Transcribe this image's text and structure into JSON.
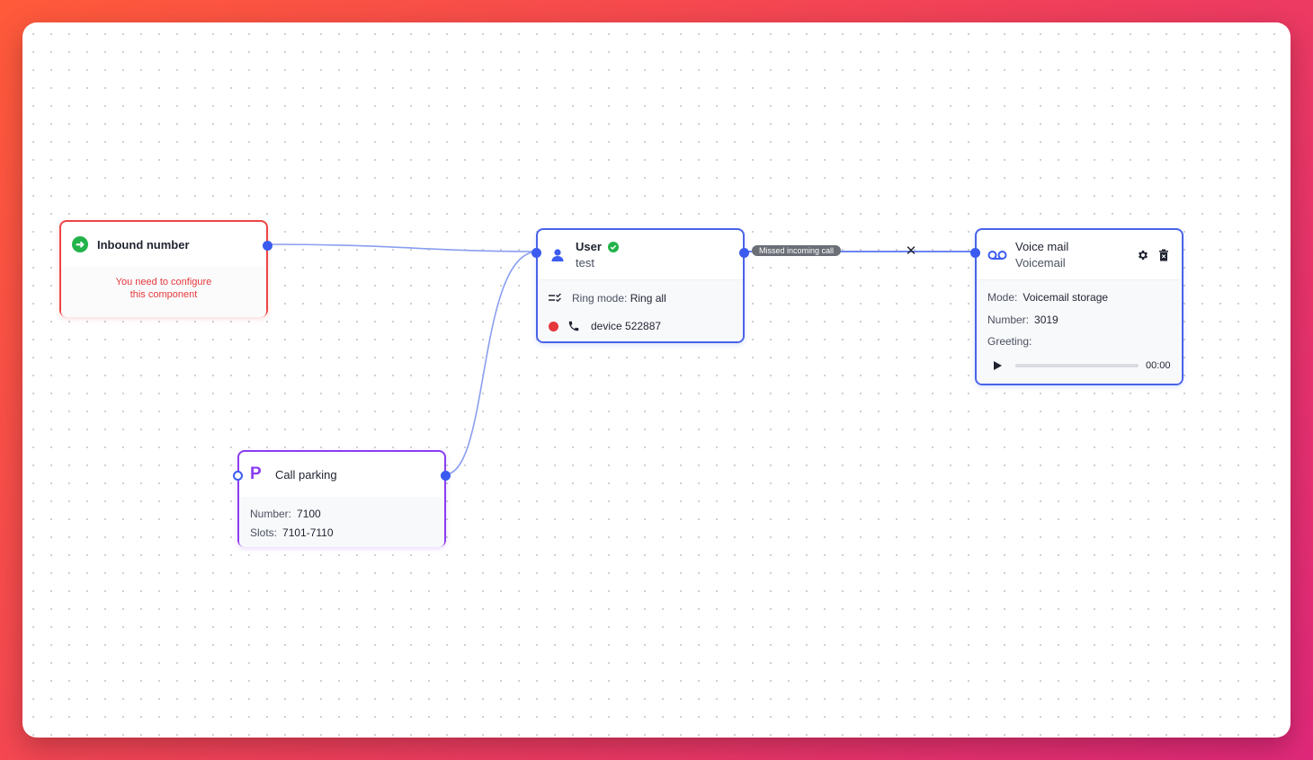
{
  "nodes": {
    "inbound": {
      "title": "Inbound number",
      "warning_line1": "You need to configure",
      "warning_line2": "this component"
    },
    "user": {
      "title": "User",
      "subtitle": "test",
      "ring_mode_label": "Ring mode:",
      "ring_mode_value": "Ring all",
      "device_label": "device 522887"
    },
    "voicemail": {
      "title": "Voice mail",
      "subtitle": "Voicemail",
      "mode_label": "Mode:",
      "mode_value": "Voicemail storage",
      "number_label": "Number:",
      "number_value": "3019",
      "greeting_label": "Greeting:",
      "time": "00:00"
    },
    "parking": {
      "title": "Call parking",
      "number_label": "Number:",
      "number_value": "7100",
      "slots_label": "Slots:",
      "slots_value": "7101-7110"
    }
  },
  "edges": {
    "missed_label": "Missed incoming call"
  },
  "colors": {
    "accent": "#3b5bf0",
    "error": "#e5383b",
    "parking": "#8b3cf0",
    "success": "#22b34a"
  },
  "icons": [
    "arrow-right-icon",
    "user-icon",
    "check-badge-icon",
    "list-check-icon",
    "phone-icon",
    "voicemail-icon",
    "gear-icon",
    "trash-icon",
    "play-icon",
    "parking-icon",
    "close-icon"
  ]
}
